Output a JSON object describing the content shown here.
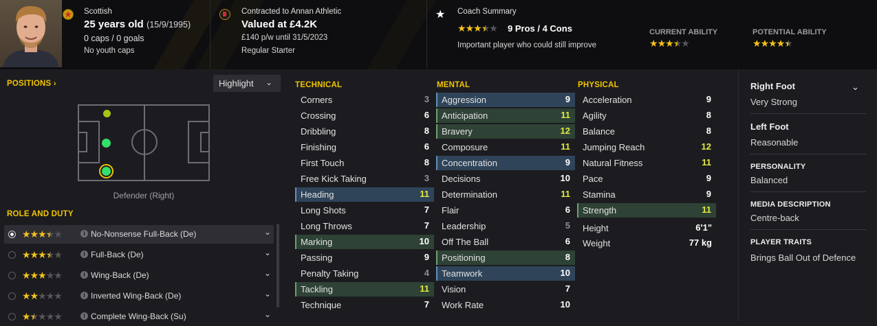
{
  "header": {
    "nationality": "Scottish",
    "age": "25 years old",
    "dob": "(15/9/1995)",
    "caps": "0 caps / 0 goals",
    "youth": "No youth caps",
    "contract": "Contracted to Annan Athletic",
    "value": "Valued at £4.2K",
    "wage": "£140 p/w until 31/5/2023",
    "status": "Regular Starter",
    "coach_title": "Coach Summary",
    "pros_cons": "9 Pros / 4 Cons",
    "coach_desc": "Important player who could still improve",
    "current_ability_label": "CURRENT ABILITY",
    "potential_ability_label": "POTENTIAL ABILITY",
    "coach_stars": 3.5,
    "current_ability_stars": 3.5,
    "potential_ability_stars": 4.5
  },
  "positions": {
    "title": "POSITIONS",
    "highlight_label": "Highlight",
    "position_label": "Defender (Right)"
  },
  "role_duty": {
    "title": "ROLE AND DUTY",
    "roles": [
      {
        "stars": 3.5,
        "label": "No-Nonsense Full-Back (De)",
        "selected": true
      },
      {
        "stars": 3.5,
        "label": "Full-Back (De)",
        "selected": false
      },
      {
        "stars": 3,
        "label": "Wing-Back (De)",
        "selected": false
      },
      {
        "stars": 2,
        "label": "Inverted Wing-Back (De)",
        "selected": false
      },
      {
        "stars": 1.5,
        "label": "Complete Wing-Back (Su)",
        "selected": false
      }
    ]
  },
  "technical": {
    "title": "TECHNICAL",
    "attrs": [
      {
        "name": "Corners",
        "value": "3"
      },
      {
        "name": "Crossing",
        "value": "6"
      },
      {
        "name": "Dribbling",
        "value": "8"
      },
      {
        "name": "Finishing",
        "value": "6"
      },
      {
        "name": "First Touch",
        "value": "8"
      },
      {
        "name": "Free Kick Taking",
        "value": "3"
      },
      {
        "name": "Heading",
        "value": "11"
      },
      {
        "name": "Long Shots",
        "value": "7"
      },
      {
        "name": "Long Throws",
        "value": "7"
      },
      {
        "name": "Marking",
        "value": "10"
      },
      {
        "name": "Passing",
        "value": "9"
      },
      {
        "name": "Penalty Taking",
        "value": "4"
      },
      {
        "name": "Tackling",
        "value": "11"
      },
      {
        "name": "Technique",
        "value": "7"
      }
    ]
  },
  "mental": {
    "title": "MENTAL",
    "attrs": [
      {
        "name": "Aggression",
        "value": "9"
      },
      {
        "name": "Anticipation",
        "value": "11"
      },
      {
        "name": "Bravery",
        "value": "12"
      },
      {
        "name": "Composure",
        "value": "11"
      },
      {
        "name": "Concentration",
        "value": "9"
      },
      {
        "name": "Decisions",
        "value": "10"
      },
      {
        "name": "Determination",
        "value": "11"
      },
      {
        "name": "Flair",
        "value": "6"
      },
      {
        "name": "Leadership",
        "value": "5"
      },
      {
        "name": "Off The Ball",
        "value": "6"
      },
      {
        "name": "Positioning",
        "value": "8"
      },
      {
        "name": "Teamwork",
        "value": "10"
      },
      {
        "name": "Vision",
        "value": "7"
      },
      {
        "name": "Work Rate",
        "value": "10"
      }
    ]
  },
  "physical": {
    "title": "PHYSICAL",
    "attrs": [
      {
        "name": "Acceleration",
        "value": "9"
      },
      {
        "name": "Agility",
        "value": "8"
      },
      {
        "name": "Balance",
        "value": "8"
      },
      {
        "name": "Jumping Reach",
        "value": "12"
      },
      {
        "name": "Natural Fitness",
        "value": "11"
      },
      {
        "name": "Pace",
        "value": "9"
      },
      {
        "name": "Stamina",
        "value": "9"
      },
      {
        "name": "Strength",
        "value": "11"
      }
    ],
    "height_label": "Height",
    "height": "6'1\"",
    "weight_label": "Weight",
    "weight": "77 kg"
  },
  "info": {
    "right_foot_label": "Right Foot",
    "right_foot": "Very Strong",
    "left_foot_label": "Left Foot",
    "left_foot": "Reasonable",
    "personality_label": "PERSONALITY",
    "personality": "Balanced",
    "media_label": "MEDIA DESCRIPTION",
    "media": "Centre-back",
    "traits_label": "PLAYER TRAITS",
    "traits": "Brings Ball Out of Defence"
  },
  "colors": {
    "accent": "#f2c500",
    "highlight_blue": "#2f4459",
    "highlight_green": "#2e4236",
    "value_strong": "#e4ea40",
    "value_normal": "#ffffff",
    "value_weak": "#8f8f94"
  }
}
